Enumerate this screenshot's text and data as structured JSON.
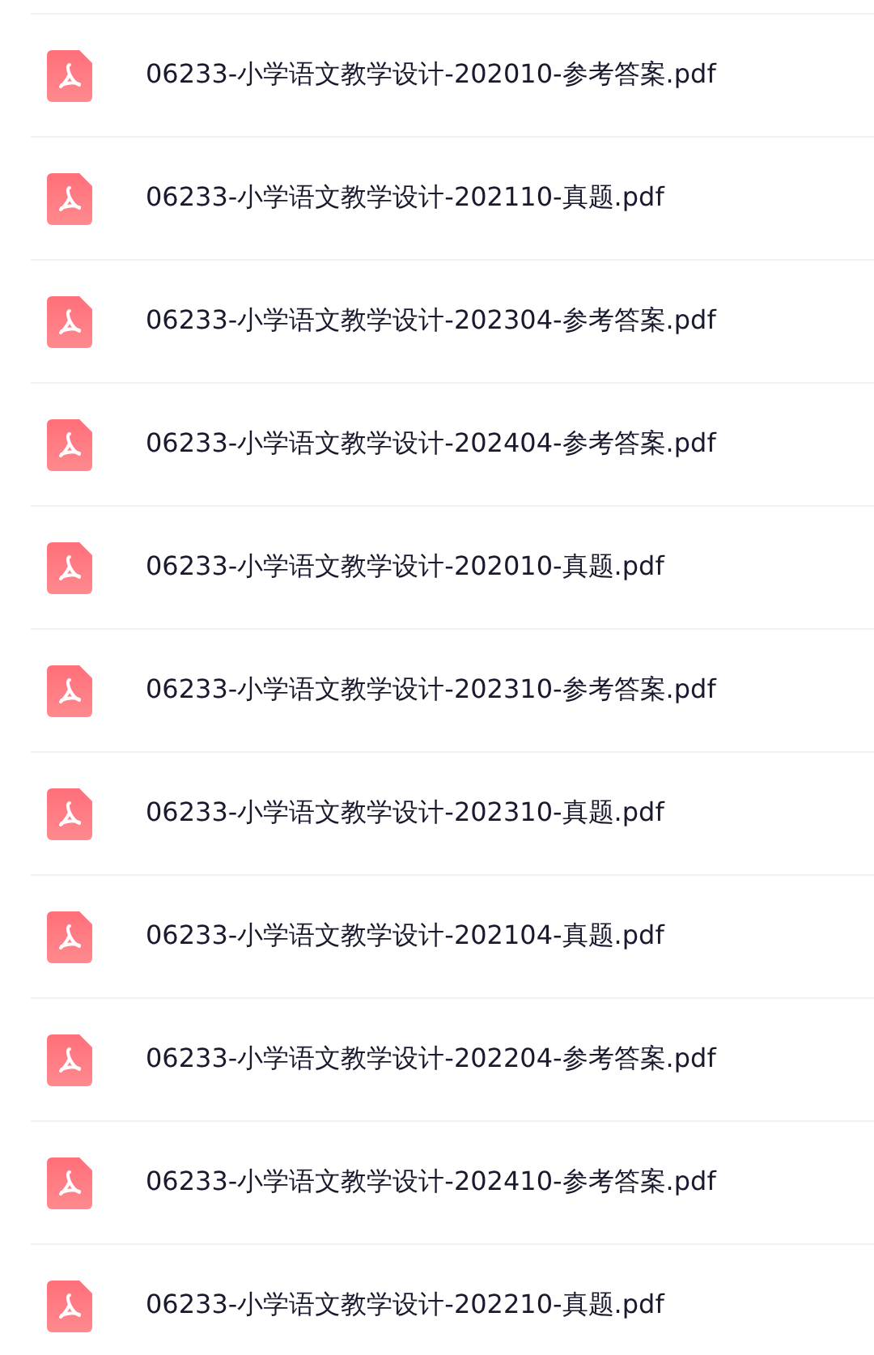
{
  "files": [
    {
      "name": "06233-小学语文教学设计-202010-参考答案.pdf"
    },
    {
      "name": "06233-小学语文教学设计-202110-真题.pdf"
    },
    {
      "name": "06233-小学语文教学设计-202304-参考答案.pdf"
    },
    {
      "name": "06233-小学语文教学设计-202404-参考答案.pdf"
    },
    {
      "name": "06233-小学语文教学设计-202010-真题.pdf"
    },
    {
      "name": "06233-小学语文教学设计-202310-参考答案.pdf"
    },
    {
      "name": "06233-小学语文教学设计-202310-真题.pdf"
    },
    {
      "name": "06233-小学语文教学设计-202104-真题.pdf"
    },
    {
      "name": "06233-小学语文教学设计-202204-参考答案.pdf"
    },
    {
      "name": "06233-小学语文教学设计-202410-参考答案.pdf"
    },
    {
      "name": "06233-小学语文教学设计-202210-真题.pdf"
    }
  ]
}
